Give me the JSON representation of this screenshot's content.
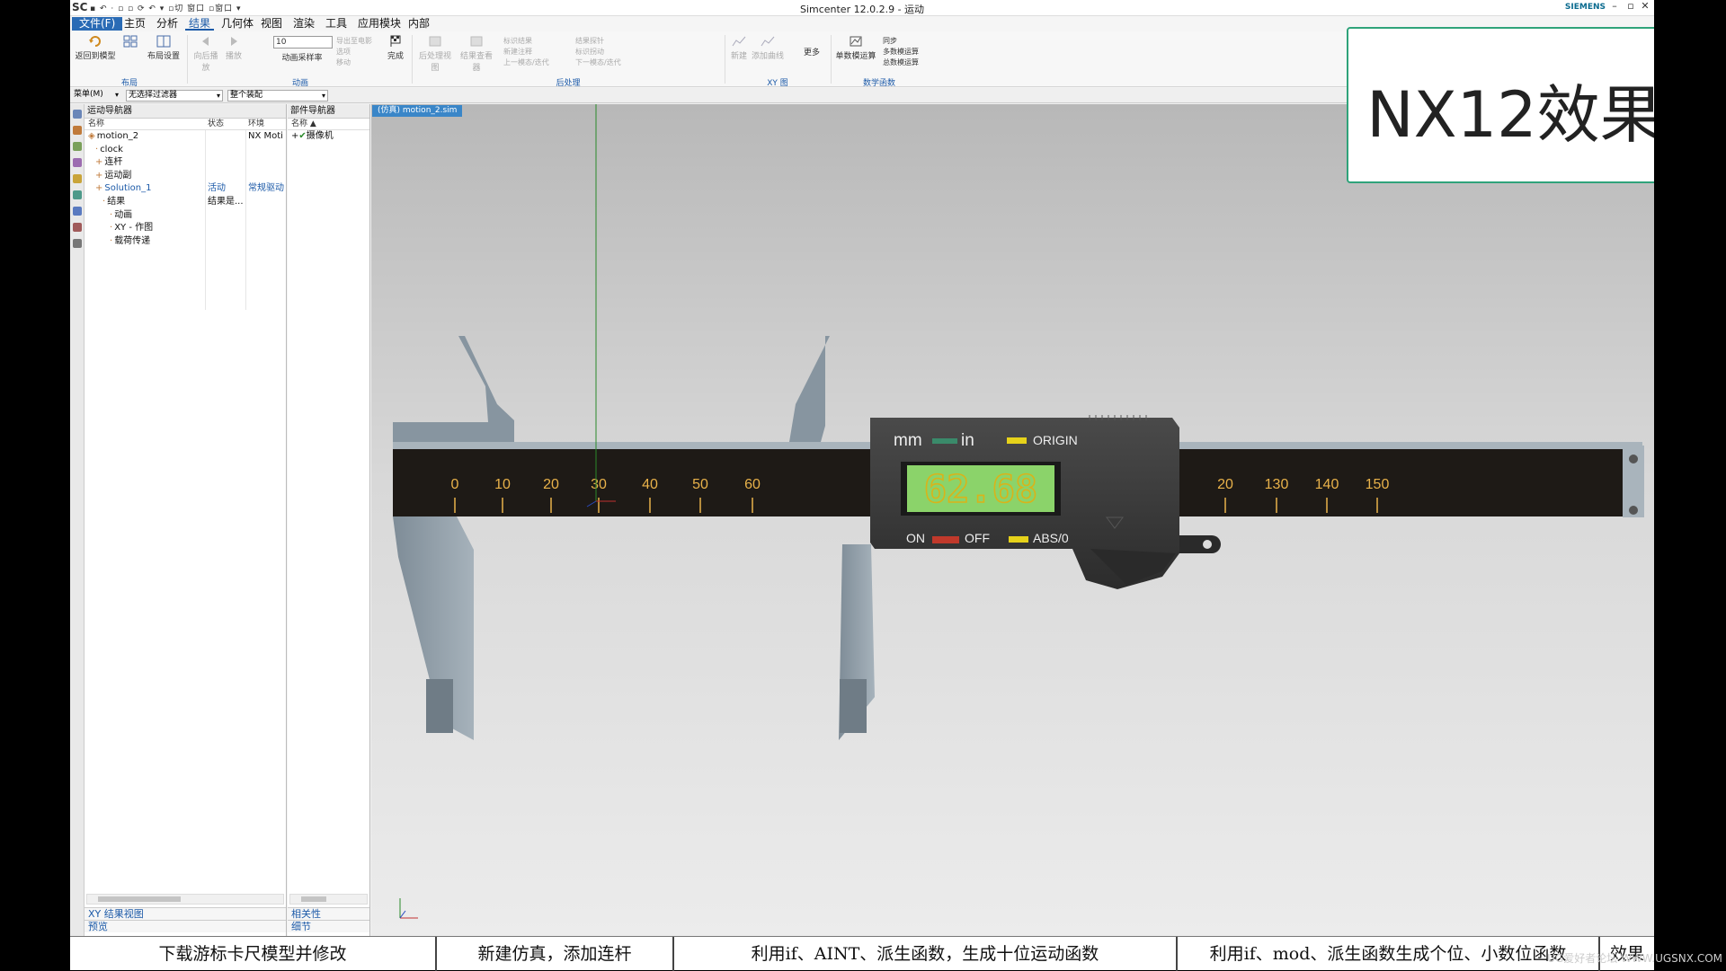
{
  "titlebar": {
    "logo": "SC",
    "qat": "▪ ↶ · ▫ ▫ ⟳ ↶ ▾ ▫切 窗口 ▫窗口 ▾",
    "title": "Simcenter 12.0.2.9 - 运动",
    "brand": "SIEMENS",
    "win_min": "–",
    "win_max": "▫",
    "win_close": "✕"
  },
  "menubar": {
    "tabs": [
      {
        "label": "文件(F)"
      },
      {
        "label": "主页"
      },
      {
        "label": "分析"
      },
      {
        "label": "结果"
      },
      {
        "label": "几何体"
      },
      {
        "label": "视图"
      },
      {
        "label": "渲染"
      },
      {
        "label": "工具"
      },
      {
        "label": "应用模块"
      },
      {
        "label": "内部"
      }
    ],
    "active_tab": "结果"
  },
  "ribbon": {
    "btn_return": "返回到模型",
    "btn_layout": "布局设置",
    "group_layout": "布局",
    "btn_play": "向后播放",
    "btn_play2": "播放",
    "anim_value": "10",
    "btn_sample": "动画采样率",
    "mini_anim1": "导出至电影",
    "mini_anim2": "选项",
    "mini_anim3": "移动",
    "btn_finish": "完成",
    "group_anim": "动画",
    "btn_postview": "后处理视图",
    "btn_resultview": "结果查看器",
    "mini_post1": "标识结果",
    "mini_post2": "新建注释",
    "mini_post3": "上一模态/迭代",
    "mini_post4": "结果探针",
    "mini_post5": "标识拐动",
    "mini_post6": "下一模态/迭代",
    "group_post": "后处理",
    "btn_new": "新建",
    "btn_add": "添加曲线",
    "group_xy": "XY 图",
    "btn_more": "更多",
    "btn_single": "单数模运算",
    "mini_math1": "同步",
    "mini_math2": "多数模运算",
    "mini_math3": "总数模运算",
    "group_math": "数学函数"
  },
  "filterbar": {
    "menu": "菜单(M)",
    "filter": "无选择过滤器",
    "assembly": "整个装配"
  },
  "motion_nav": {
    "title": "运动导航器",
    "col_name": "名称",
    "col_state": "状态",
    "col_env": "环境",
    "rows": [
      {
        "indent": 0,
        "label": "motion_2",
        "state": "",
        "env": "NX Moti",
        "blue": false
      },
      {
        "indent": 1,
        "label": "clock",
        "state": "",
        "env": "",
        "blue": false
      },
      {
        "indent": 1,
        "label": "连杆",
        "state": "",
        "env": "",
        "blue": false
      },
      {
        "indent": 1,
        "label": "运动副",
        "state": "",
        "env": "",
        "blue": false
      },
      {
        "indent": 1,
        "label": "Solution_1",
        "state": "活动",
        "env": "常规驱动",
        "blue": true
      },
      {
        "indent": 2,
        "label": "结果",
        "state": "结果是...",
        "env": "",
        "blue": false
      },
      {
        "indent": 3,
        "label": "动画",
        "state": "",
        "env": "",
        "blue": false
      },
      {
        "indent": 3,
        "label": "XY - 作图",
        "state": "",
        "env": "",
        "blue": false
      },
      {
        "indent": 3,
        "label": "载荷传递",
        "state": "",
        "env": "",
        "blue": false
      }
    ],
    "footer1": "XY 结果视图",
    "footer2": "预览"
  },
  "part_nav": {
    "title": "部件导航器",
    "col_name": "名称",
    "rows": [
      {
        "label": "摄像机"
      }
    ],
    "footer1": "相关性",
    "footer2": "细节"
  },
  "viewport": {
    "tab_label": "(仿真) motion_2.sim"
  },
  "caliper": {
    "ticks": [
      "0",
      "10",
      "20",
      "30",
      "40",
      "50",
      "60",
      "20",
      "130",
      "140",
      "150"
    ],
    "lcd_value": "62.68",
    "display_unit_mm": "mm",
    "display_unit_in": "in",
    "origin_label": "ORIGIN",
    "on_label": "ON",
    "off_label": "OFF",
    "abs_label": "ABS/0",
    "lcd_color": "#8bd36a",
    "body_color": "#3a3a3a",
    "jaw_color": "#8a98a3"
  },
  "overlay": {
    "text": "NX12效果"
  },
  "captions": [
    {
      "text": "下载游标卡尺模型并修改"
    },
    {
      "text": "新建仿真，添加连杆"
    },
    {
      "text": "利用if、AINT、派生函数，生成十位运动函数"
    },
    {
      "text": "利用if、mod、派生函数生成个位、小数位函数"
    },
    {
      "text": "效果"
    }
  ],
  "watermark": "UG爱好者论坛 WWW.UGSNX.COM"
}
